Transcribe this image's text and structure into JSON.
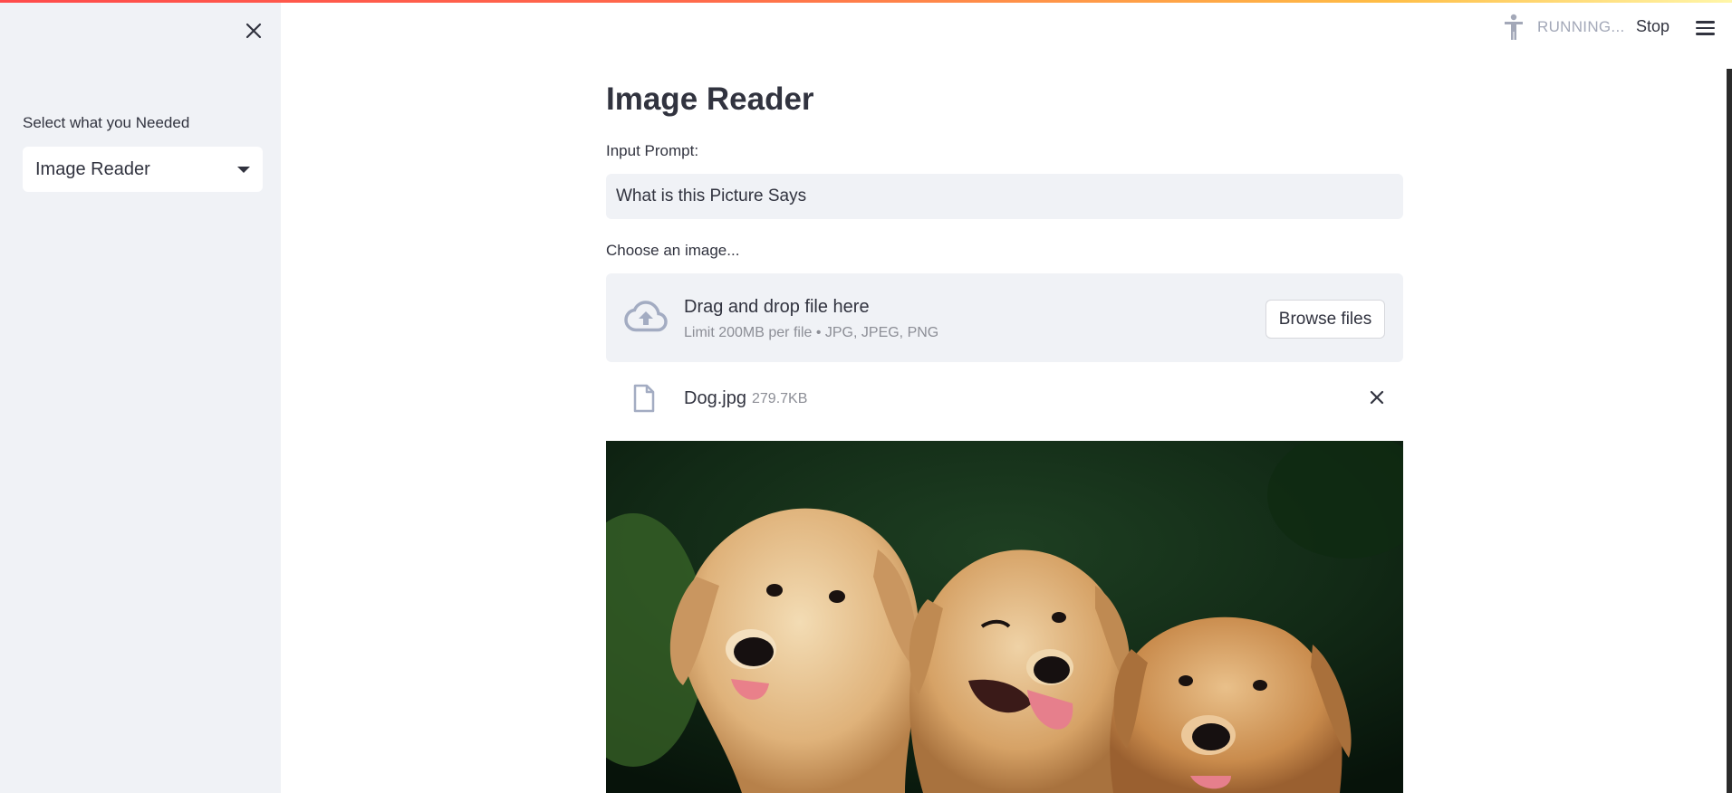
{
  "sidebar": {
    "close_icon": "close-icon",
    "label": "Select what you Needed",
    "select_value": "Image Reader"
  },
  "header": {
    "status_text": "RUNNING...",
    "status_icon": "running-man-icon",
    "stop_label": "Stop",
    "menu_icon": "hamburger-menu-icon"
  },
  "main": {
    "title": "Image Reader",
    "prompt_label": "Input Prompt:",
    "prompt_value": "What is this Picture Says",
    "uploader_label": "Choose an image...",
    "dropzone": {
      "title": "Drag and drop file here",
      "subtitle": "Limit 200MB per file • JPG, JPEG, PNG",
      "browse_label": "Browse files",
      "icon": "cloud-upload-icon"
    },
    "file": {
      "name": "Dog.jpg",
      "size": "279.7KB",
      "icon": "file-icon",
      "remove_icon": "close-icon"
    },
    "image_content": "three golden retriever puppies"
  },
  "colors": {
    "sidebar_bg": "#f0f2f6",
    "text": "#31333f",
    "muted": "#8c8e96",
    "accent": "#ff4b4b"
  }
}
